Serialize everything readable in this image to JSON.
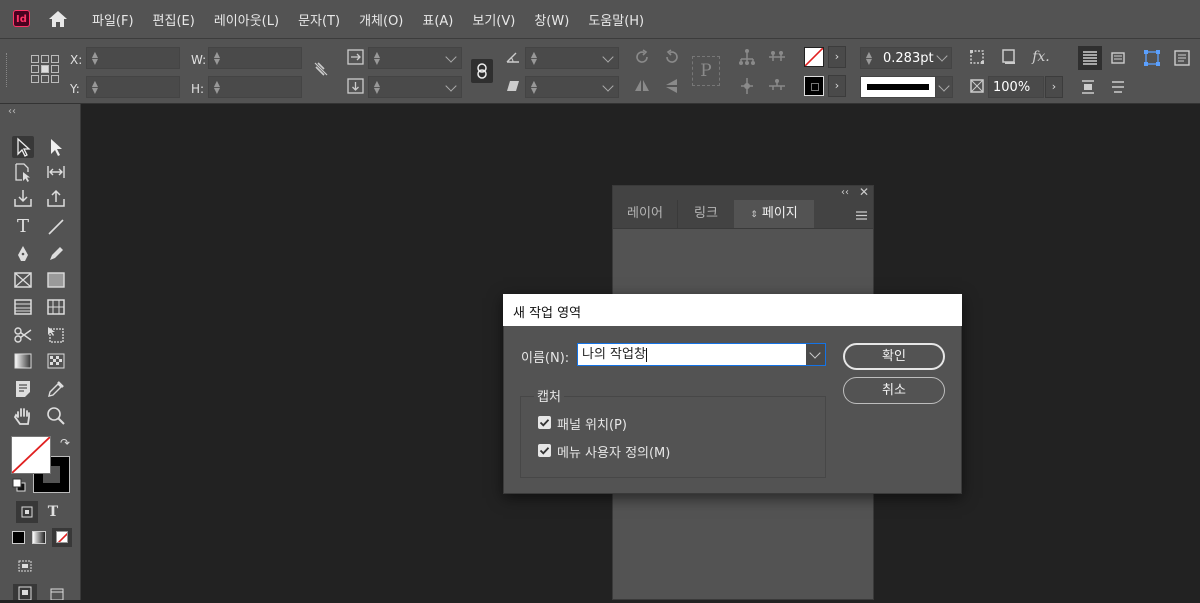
{
  "app": {
    "logo_text": "Id",
    "accent": "#ff3366"
  },
  "menu": [
    "파일(F)",
    "편집(E)",
    "레이아웃(L)",
    "문자(T)",
    "개체(O)",
    "표(A)",
    "보기(V)",
    "창(W)",
    "도움말(H)"
  ],
  "control_panel": {
    "x_label": "X:",
    "y_label": "Y:",
    "w_label": "W:",
    "h_label": "H:",
    "stroke_weight": "0.283pt",
    "opacity": "100%",
    "fx_label": "fx."
  },
  "pages_panel": {
    "tabs": [
      "레이어",
      "링크",
      "페이지"
    ],
    "active_tab": "페이지"
  },
  "dialog": {
    "title": "새 작업 영역",
    "name_label": "이름(N):",
    "name_value": "나의 작업창",
    "ok_label": "확인",
    "cancel_label": "취소",
    "capture_group": "캡처",
    "checkboxes": [
      {
        "label": "패널 위치(P)",
        "checked": true
      },
      {
        "label": "메뉴 사용자 정의(M)",
        "checked": true
      }
    ]
  },
  "toolbar": {
    "type_tool_label": "T"
  }
}
